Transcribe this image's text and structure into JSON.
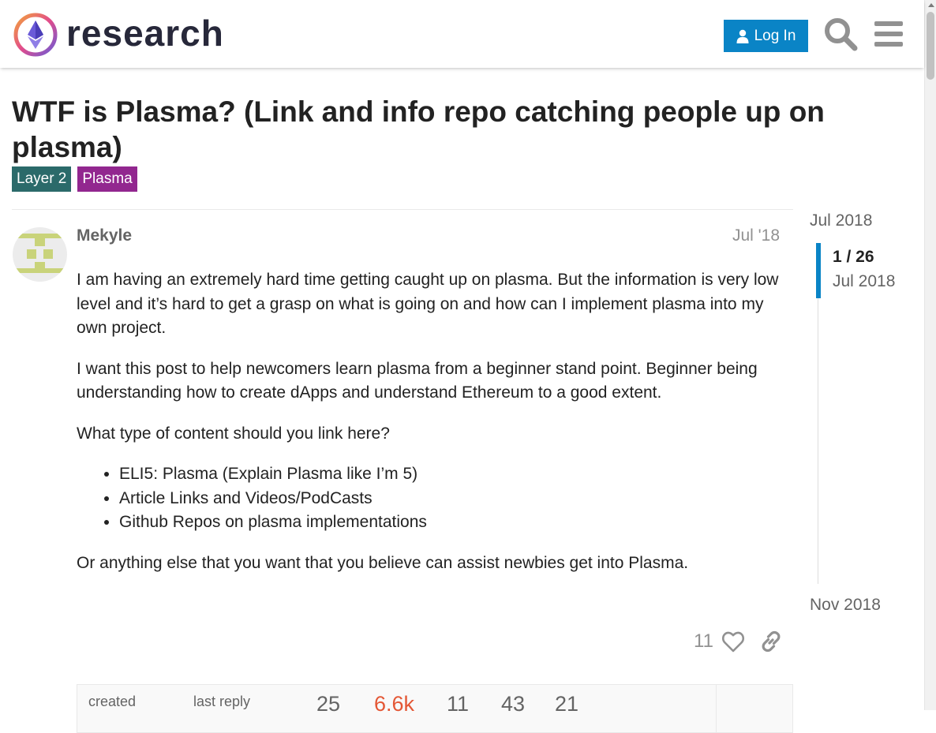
{
  "header": {
    "logo_text": "research",
    "login_label": "Log In"
  },
  "topic": {
    "title": "WTF is Plasma? (Link and info repo catching people up on plasma)",
    "tags": [
      "Layer 2",
      "Plasma"
    ]
  },
  "post": {
    "username": "Mekyle",
    "date": "Jul '18",
    "paragraphs": [
      "I am having an extremely hard time getting caught up on plasma. But the information is very low level and it’s hard to get a grasp on what is going on and how can I implement plasma into my own project.",
      "I want this post to help newcomers learn plasma from a beginner stand point. Beginner being understanding how to create dApps and understand Ethereum to a good extent.",
      "What type of content should you link here?"
    ],
    "list_items": [
      "ELI5: Plasma (Explain Plasma like I’m 5)",
      "Article Links and Videos/PodCasts",
      "Github Repos on plasma implementations"
    ],
    "closing": "Or anything else that you want that you believe can assist newbies get into Plasma.",
    "like_count": "11"
  },
  "topic_map": {
    "created_label": "created",
    "last_reply_label": "last reply",
    "replies": "25",
    "views": "6.6k",
    "users": "11",
    "likes": "43",
    "links": "21"
  },
  "timeline": {
    "start": "Jul 2018",
    "position": "1 / 26",
    "current_date": "Jul 2018",
    "end": "Nov 2018"
  },
  "colors": {
    "accent": "#0a84c6",
    "tag_layer2": "#2b6a6a",
    "tag_plasma": "#92278f",
    "views_hot": "#e45735"
  }
}
